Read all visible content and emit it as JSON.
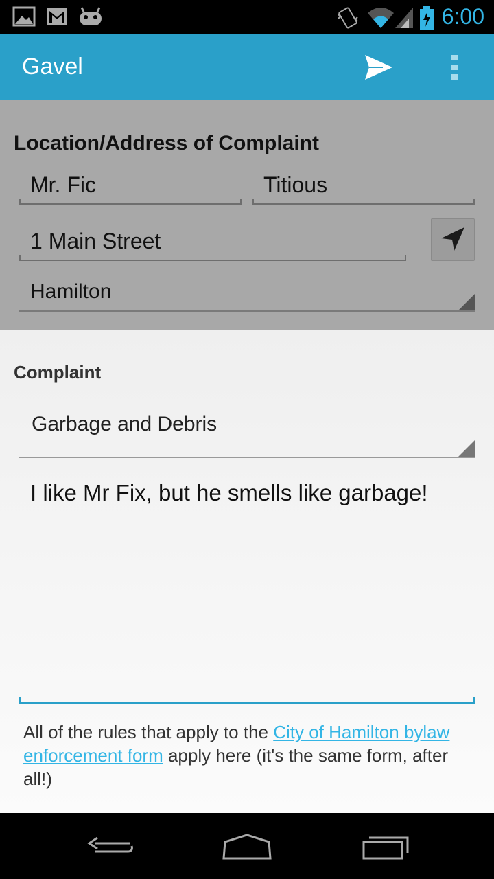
{
  "status_bar": {
    "time": "6:00",
    "icons": [
      "image-notification-icon",
      "gmail-icon",
      "android-icon",
      "vibrate-icon",
      "wifi-icon",
      "signal-icon",
      "battery-charging-icon"
    ]
  },
  "action_bar": {
    "title": "Gavel",
    "actions": [
      "send-icon",
      "overflow-menu-icon"
    ]
  },
  "location": {
    "heading": "Location/Address of Complaint",
    "first_name": "Mr. Fic",
    "last_name": "Titious",
    "street": "1 Main Street",
    "city": "Hamilton"
  },
  "complaint": {
    "heading": "Complaint",
    "type": "Garbage and Debris",
    "text": "I like Mr Fix, but he smells like garbage!"
  },
  "footer": {
    "prefix": "All of the rules that apply to the ",
    "link_text": "City of Hamilton bylaw enforcement form",
    "suffix": " apply here (it's the same form, after all!)"
  },
  "colors": {
    "action_bar": "#2aa0c9",
    "accent": "#33b5e5"
  }
}
